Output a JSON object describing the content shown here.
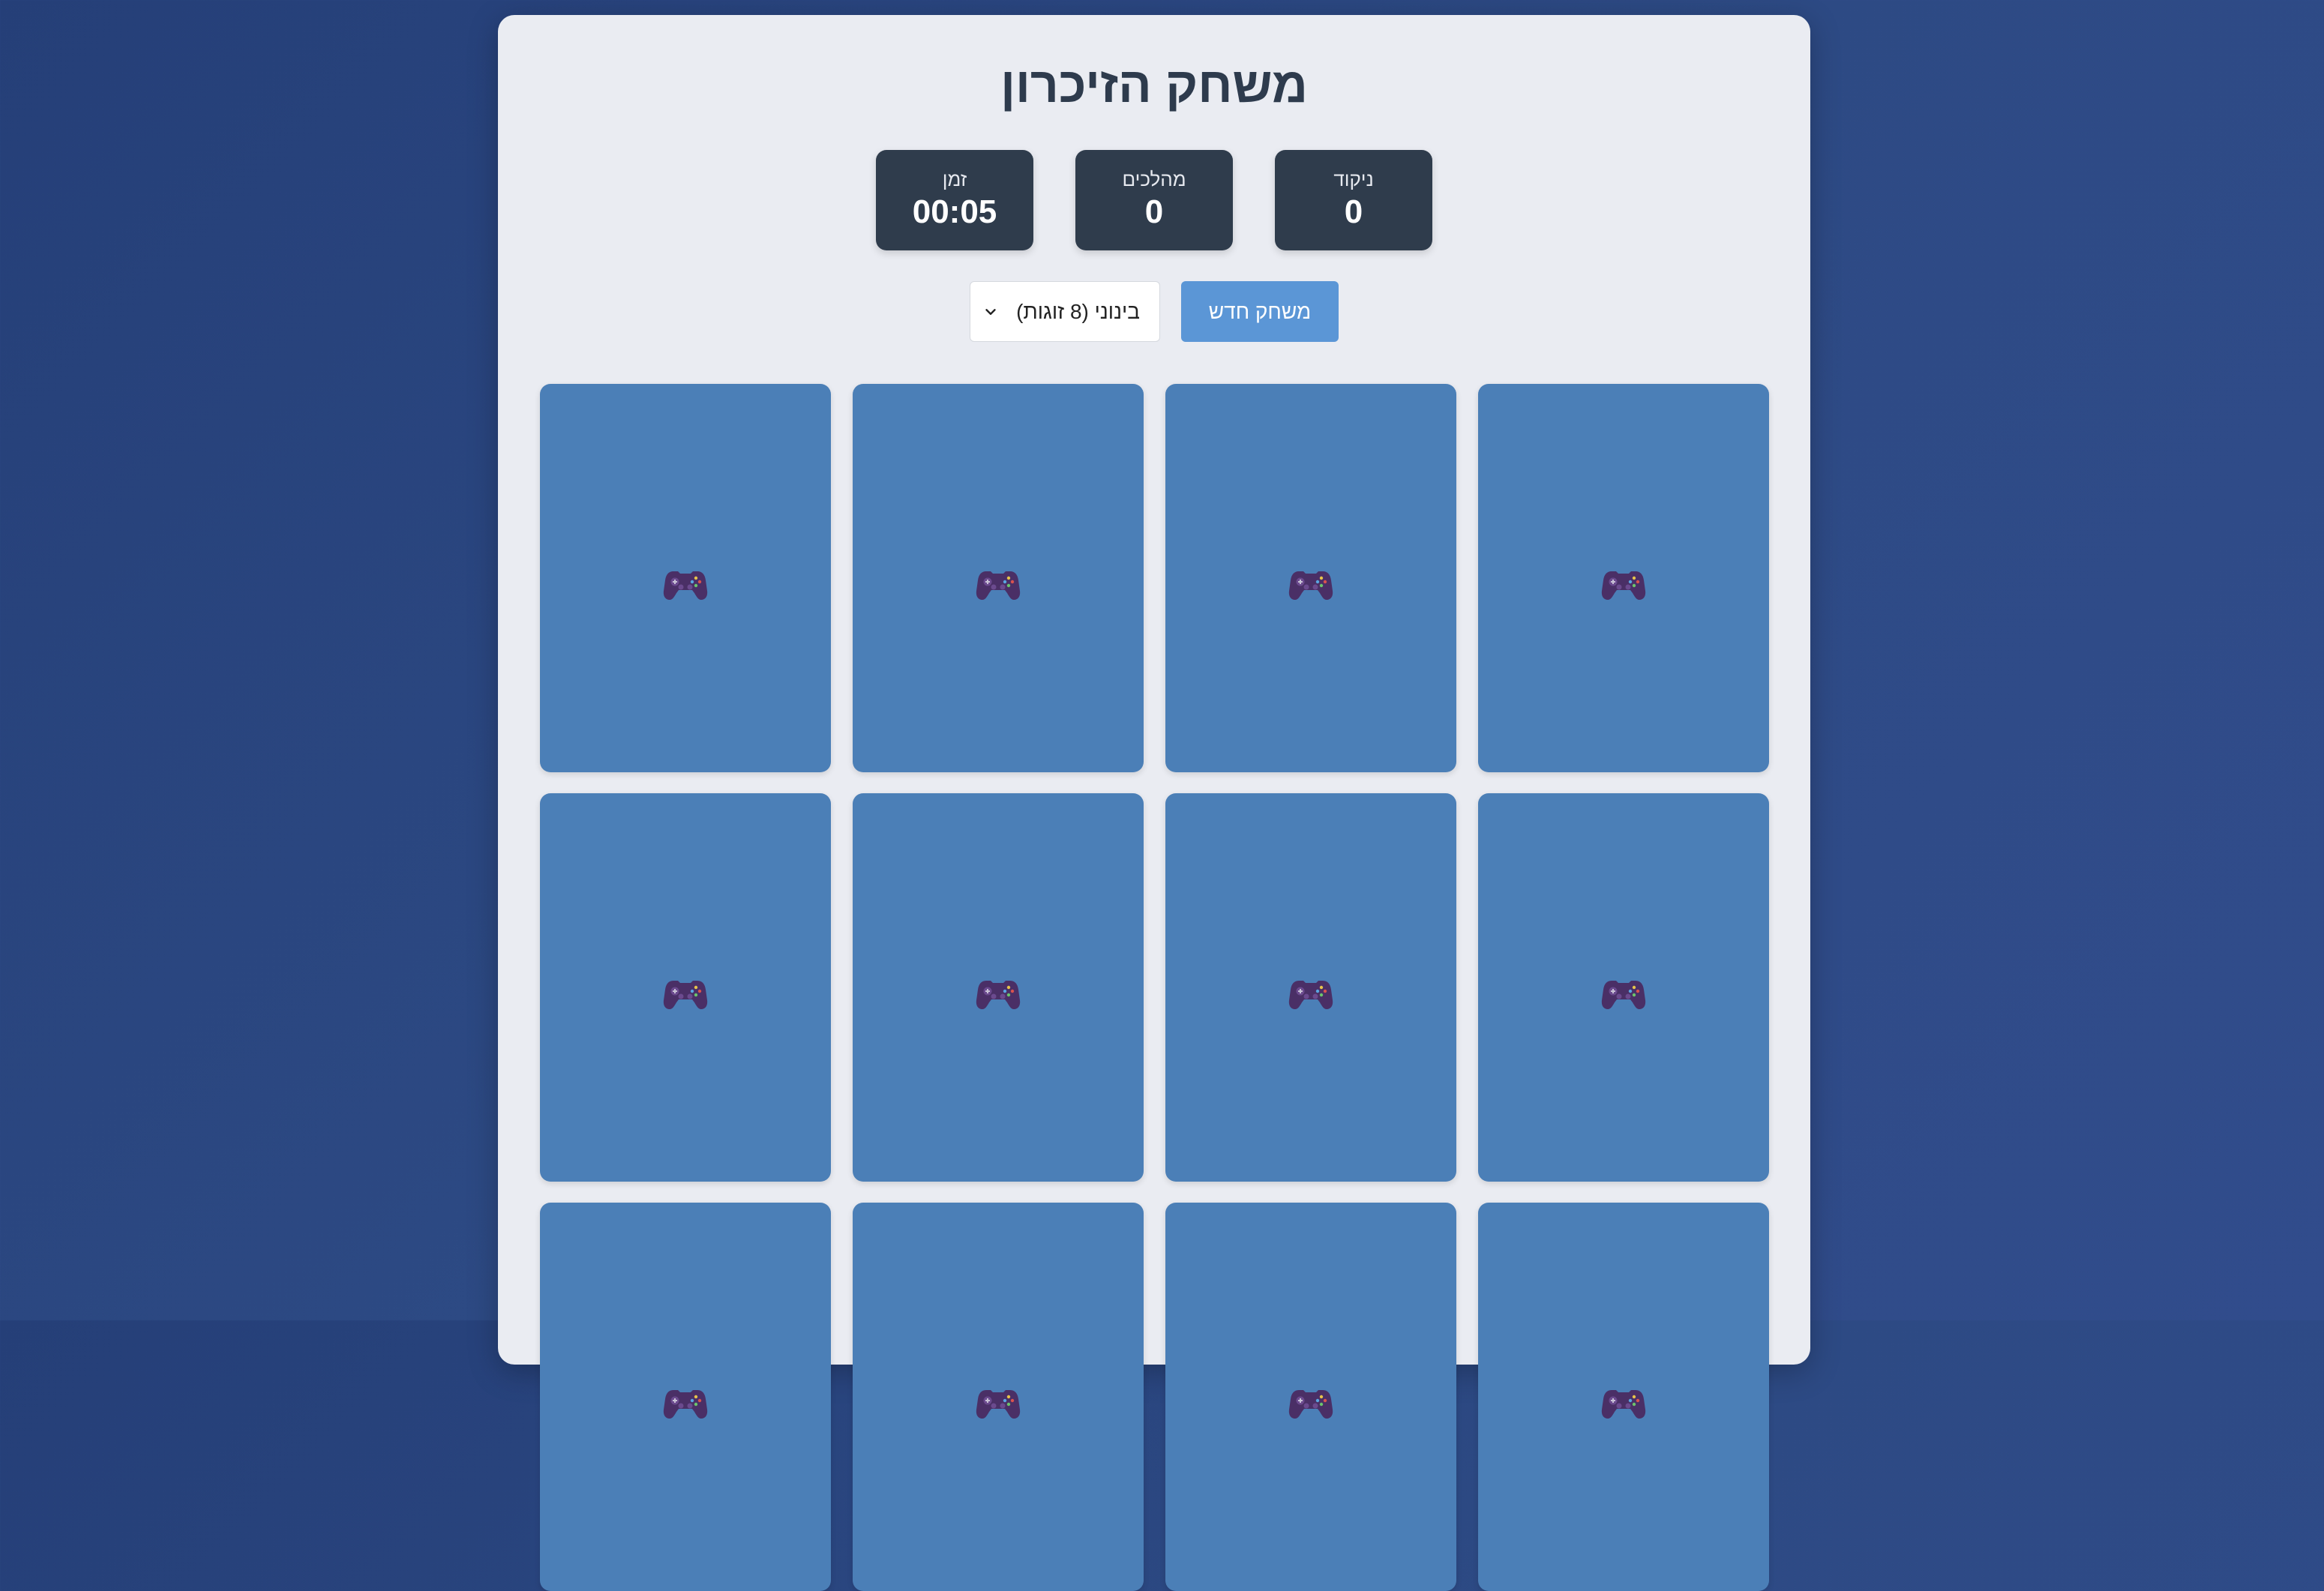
{
  "title": "משחק הזיכרון",
  "stats": {
    "score_label": "ניקוד",
    "score_value": "0",
    "moves_label": "מהלכים",
    "moves_value": "0",
    "time_label": "זמן",
    "time_value": "00:05"
  },
  "controls": {
    "new_game_label": "משחק חדש",
    "difficulty_selected": "בינוני (8 זוגות)"
  },
  "cards": {
    "back_icon": "game-controller-icon",
    "visible_count": 12,
    "back_color": "#4b7fb7"
  },
  "colors": {
    "accent": "#5b96d6",
    "stat_bg": "#2f3c4c",
    "title": "#2e3b4d"
  }
}
